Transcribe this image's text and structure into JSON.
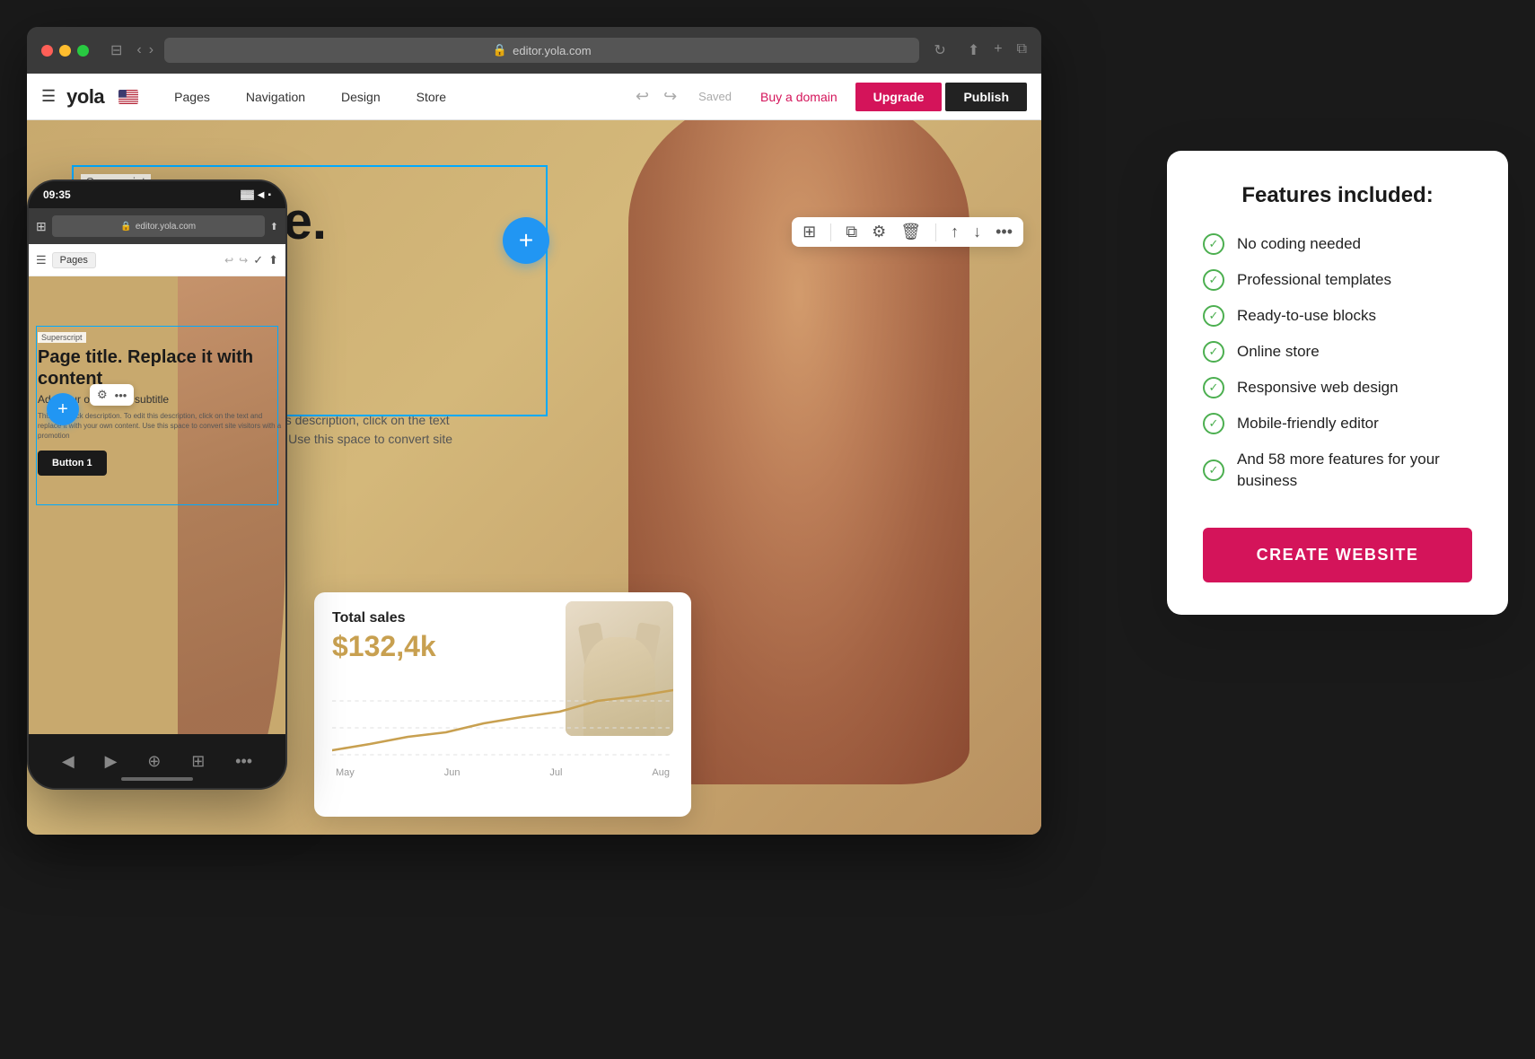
{
  "browser": {
    "url": "editor.yola.com",
    "nav_back": "‹",
    "nav_forward": "›",
    "share_icon": "⬆",
    "new_tab_icon": "+",
    "tabs_icon": "⧉",
    "privacy_icon": "🛡",
    "reload_icon": "↻"
  },
  "toolbar": {
    "menu_icon": "☰",
    "logo": "yola",
    "nav_items": [
      "Pages",
      "Navigation",
      "Design",
      "Store"
    ],
    "undo": "↩",
    "redo": "↪",
    "saved": "Saved",
    "buy_domain": "Buy a domain",
    "upgrade": "Upgrade",
    "publish": "Publish"
  },
  "editor": {
    "superscript": "Superscript",
    "page_title": "Page title. Replace content",
    "page_subtitle": "subtitle",
    "page_description": "This is a block description. To edit this description, click on the text and replace it with your own content. Use this space to convert site visitors with a promotion",
    "fab_plus": "+",
    "floating_toolbar_icons": [
      "⊞",
      "⧉",
      "⚙",
      "🗑",
      "↑",
      "↓",
      "•••"
    ]
  },
  "sales_card": {
    "title": "Total sales",
    "amount": "$132,4k",
    "months": [
      "May",
      "Jun",
      "Jul",
      "Aug"
    ]
  },
  "phone": {
    "time": "09:35",
    "url": "editor.yola.com",
    "pages_btn": "Pages",
    "superscript": "Superscript",
    "page_title": "Page title. Replace it with content",
    "subtitle": "Add your own block subtitle",
    "description": "This is a block description. To edit this description, click on the text and replace it with your own content. Use this space to convert site visitors with a promotion",
    "button_label": "Button 1",
    "status_icons": "▓▓ ◀ ◆"
  },
  "features": {
    "title": "Features included:",
    "items": [
      "No coding needed",
      "Professional templates",
      "Ready-to-use blocks",
      "Online store",
      "Responsive web design",
      "Mobile-friendly editor",
      "And 58 more features for your business"
    ],
    "create_button": "CREATE WEBSITE"
  }
}
